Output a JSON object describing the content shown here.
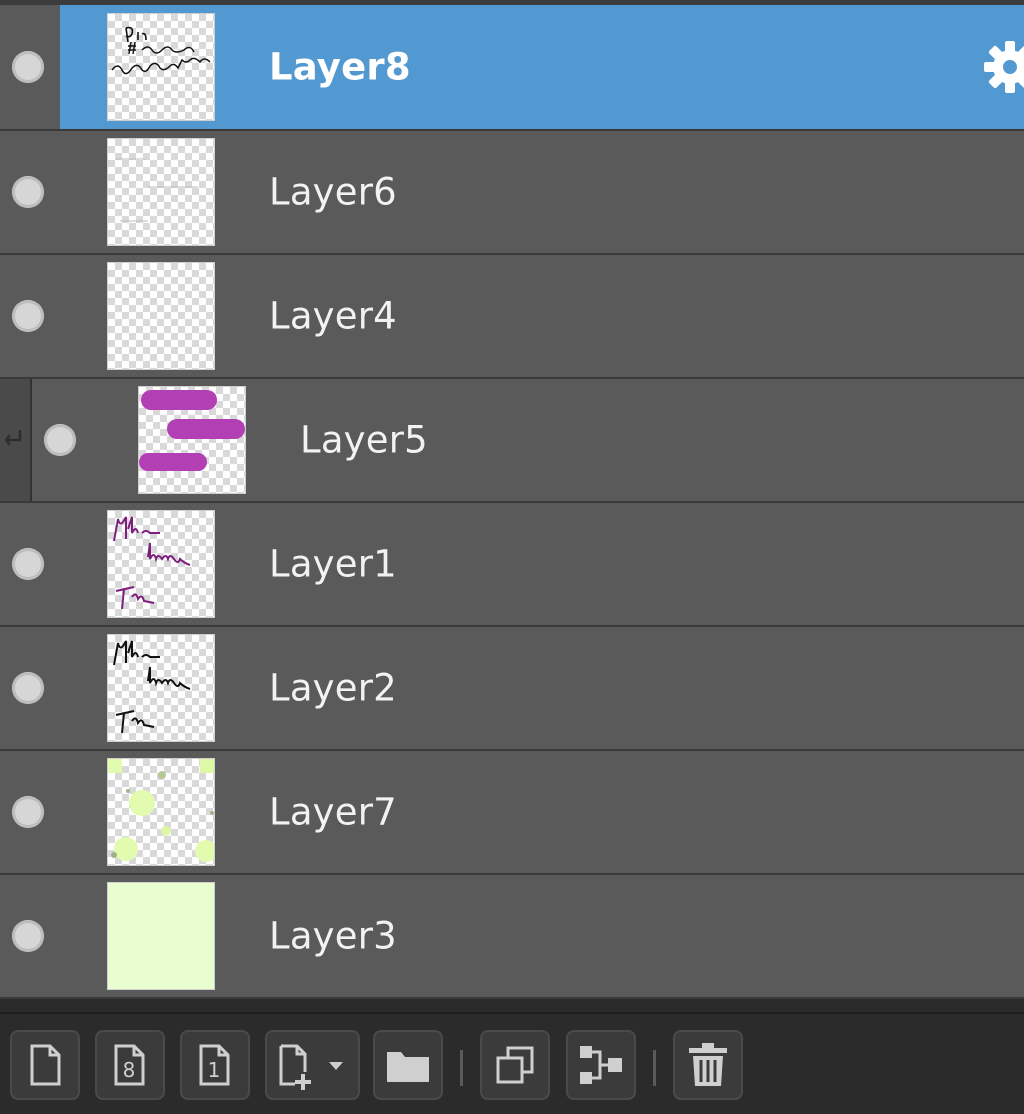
{
  "layers": [
    {
      "name": "Layer8",
      "selected": true,
      "clipped": false,
      "thumbnail": "text-black"
    },
    {
      "name": "Layer6",
      "selected": false,
      "clipped": false,
      "thumbnail": "faint-lines"
    },
    {
      "name": "Layer4",
      "selected": false,
      "clipped": false,
      "thumbnail": "empty"
    },
    {
      "name": "Layer5",
      "selected": false,
      "clipped": true,
      "thumbnail": "purple-strokes"
    },
    {
      "name": "Layer1",
      "selected": false,
      "clipped": false,
      "thumbnail": "purple-script"
    },
    {
      "name": "Layer2",
      "selected": false,
      "clipped": false,
      "thumbnail": "black-script"
    },
    {
      "name": "Layer7",
      "selected": false,
      "clipped": false,
      "thumbnail": "lime-dots"
    },
    {
      "name": "Layer3",
      "selected": false,
      "clipped": false,
      "thumbnail": "solid-lime"
    }
  ],
  "toolbar": {
    "buttons": [
      {
        "name": "new-layer-button",
        "icon": "new-page-icon"
      },
      {
        "name": "new-8bit-layer-button",
        "icon": "page-8-icon",
        "glyph": "8"
      },
      {
        "name": "new-1bit-layer-button",
        "icon": "page-1-icon",
        "glyph": "1"
      },
      {
        "name": "new-layer-menu-button",
        "icon": "add-layer-dropdown-icon"
      },
      {
        "name": "new-folder-button",
        "icon": "folder-icon"
      },
      {
        "name": "duplicate-layer-button",
        "icon": "duplicate-icon"
      },
      {
        "name": "merge-down-button",
        "icon": "merge-icon"
      },
      {
        "name": "delete-layer-button",
        "icon": "trash-icon"
      }
    ]
  },
  "colors": {
    "selected_row": "#5399d1",
    "row_bg": "#5a5a5a",
    "panel_bg": "#2b2b2b",
    "purple_stroke": "#b23fb4",
    "lime_fill": "#eafdcf"
  }
}
